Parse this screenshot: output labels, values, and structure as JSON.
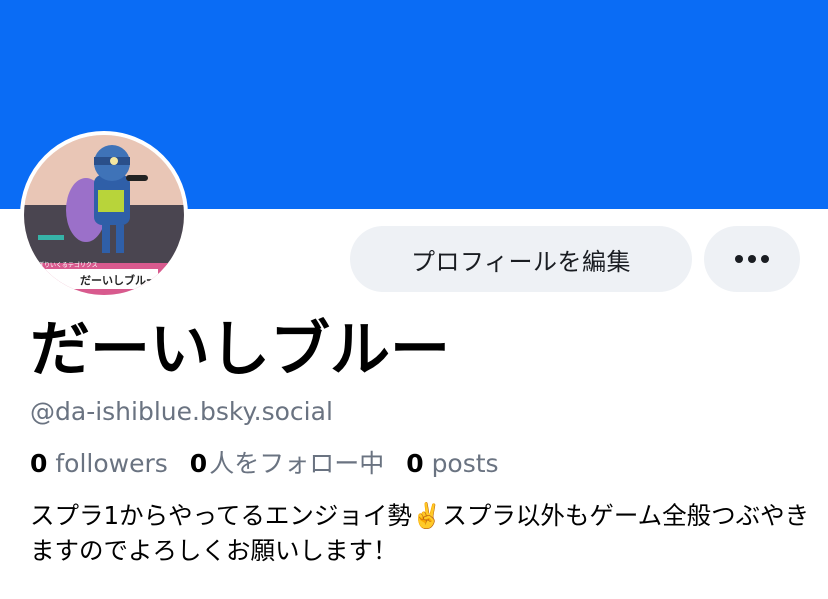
{
  "profile": {
    "banner_color": "#0a6cf5",
    "avatar": {
      "alt": "profile avatar",
      "sign_caption": "ぎりいくるテゴリクス",
      "sign_text": "だーいしブルー"
    },
    "edit_label": "プロフィールを編集",
    "more_icon": "more-horizontal-icon",
    "display_name": "だーいしブルー",
    "handle": "@da-ishiblue.bsky.social",
    "stats": {
      "followers_count": "0",
      "followers_label": "followers",
      "following_count": "0",
      "following_label": "人をフォロー中",
      "posts_count": "0",
      "posts_label": "posts"
    },
    "bio": "スプラ1からやってるエンジョイ勢✌️スプラ以外もゲーム全般つぶやきますのでよろしくお願いします！"
  }
}
